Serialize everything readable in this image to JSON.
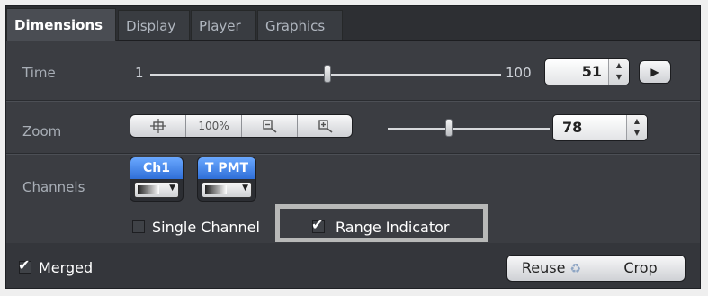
{
  "tabs": [
    {
      "label": "Dimensions",
      "active": true
    },
    {
      "label": "Display",
      "active": false
    },
    {
      "label": "Player",
      "active": false
    },
    {
      "label": "Graphics",
      "active": false
    }
  ],
  "time": {
    "label": "Time",
    "min": "1",
    "max": "100",
    "value": "51",
    "slider_fraction": 0.505
  },
  "zoom": {
    "label": "Zoom",
    "buttons": [
      {
        "label": "",
        "icon": "fit-crosshair-icon"
      },
      {
        "label": "100%",
        "icon": "zoom-100-icon"
      },
      {
        "label": "",
        "icon": "zoom-out-icon"
      },
      {
        "label": "",
        "icon": "zoom-in-icon"
      }
    ],
    "value": "78",
    "slider_fraction": 0.38
  },
  "channels": {
    "label": "Channels",
    "items": [
      {
        "label": "Ch1"
      },
      {
        "label": "T PMT"
      }
    ],
    "single_channel": {
      "label": "Single Channel",
      "checked": false
    },
    "range_indicator": {
      "label": "Range Indicator",
      "checked": true
    }
  },
  "merged": {
    "label": "Merged",
    "checked": true
  },
  "actions": {
    "reuse_label": "Reuse",
    "crop_label": "Crop"
  },
  "colors": {
    "panel_bg": "#3b3d42",
    "accent_blue": "#2f6fd8",
    "highlight_frame": "#b8b9b8"
  }
}
